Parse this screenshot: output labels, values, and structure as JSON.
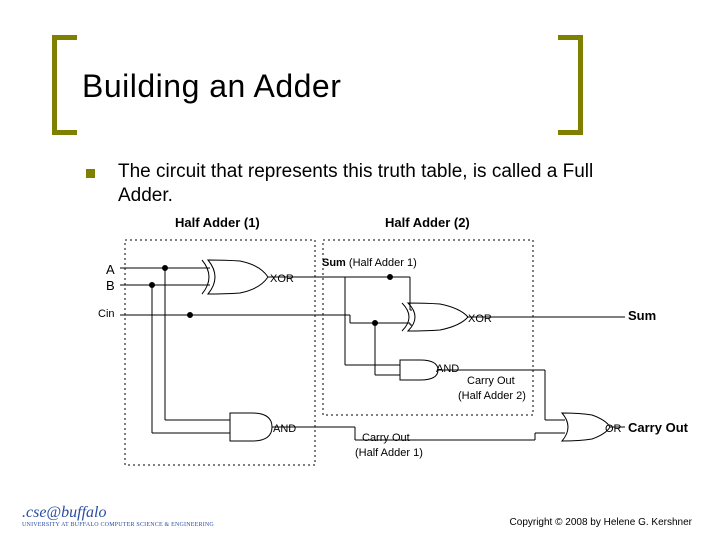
{
  "title": "Building an Adder",
  "bullet_text": "The circuit that represents this truth table, is called a Full Adder.",
  "ha1_label": "Half Adder (1)",
  "ha2_label": "Half Adder (2)",
  "inputs": {
    "A": "A",
    "B": "B",
    "Cin": "Cin"
  },
  "gates": {
    "XOR": "XOR",
    "AND": "AND",
    "OR": "OR"
  },
  "sum_ha1": "Sum",
  "sum_ha1_paren": "(Half Adder 1)",
  "carry_ha1": "Carry Out",
  "carry_ha1_paren": "(Half Adder 1)",
  "carry_ha2": "Carry Out",
  "carry_ha2_paren": "(Half Adder 2)",
  "outputs": {
    "Sum": "Sum",
    "CarryOut": "Carry Out"
  },
  "copyright": "Copyright © 2008 by Helene G. Kershner",
  "logo_text": ".cse@buffalo",
  "logo_sub": "UNIVERSITY AT BUFFALO   COMPUTER SCIENCE & ENGINEERING",
  "colors": {
    "accent": "#808000",
    "wire": "#000000"
  }
}
